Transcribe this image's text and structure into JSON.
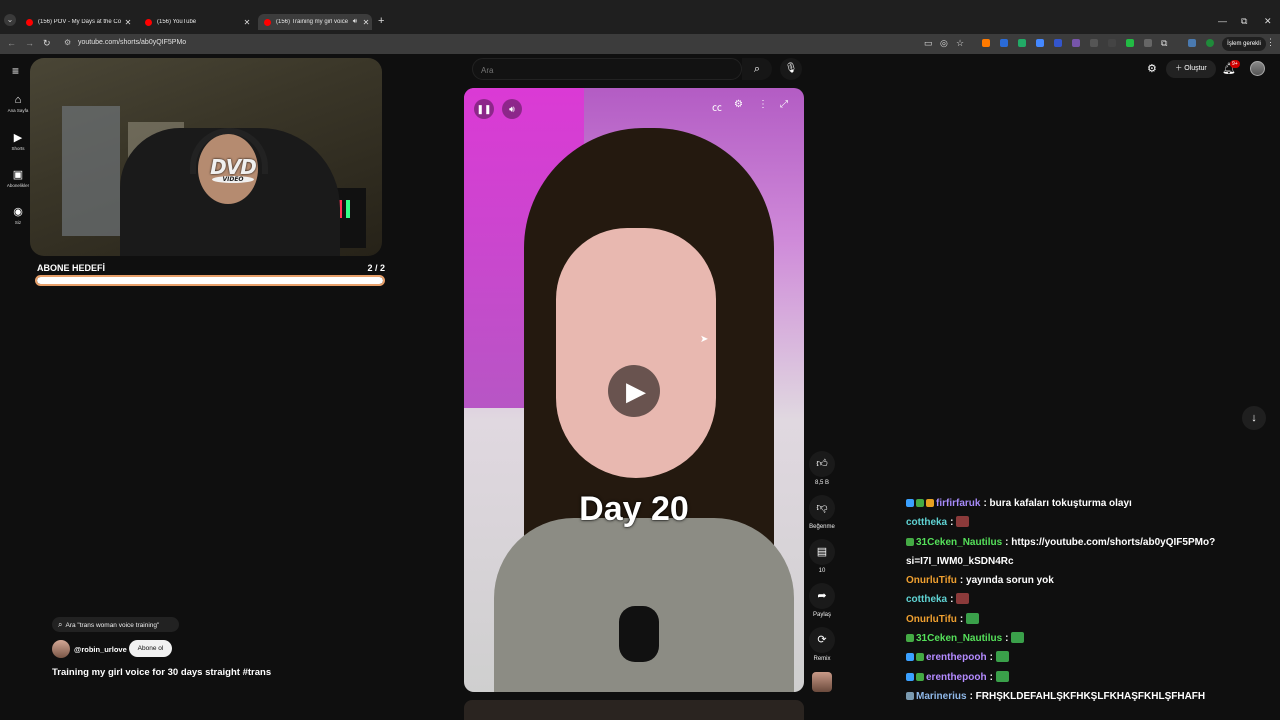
{
  "browser": {
    "tabs": [
      {
        "title": "(156) POV - My Days at the Co",
        "active": false
      },
      {
        "title": "(156) YouTube",
        "active": false
      },
      {
        "title": "(156) Training my girl voice",
        "active": true
      }
    ],
    "url": "youtube.com/shorts/ab0yQIF5PMo",
    "profile_label": "İşlem gerekli"
  },
  "youtube": {
    "sidebar": [
      {
        "label": "Ana Sayfa",
        "icon": "home-icon"
      },
      {
        "label": "Shorts",
        "icon": "shorts-icon"
      },
      {
        "label": "Abonelikler",
        "icon": "subscriptions-icon"
      },
      {
        "label": "Siz",
        "icon": "you-icon"
      }
    ],
    "search": {
      "placeholder": "Ara"
    },
    "create_label": "Oluştur",
    "notification_badge": "9+"
  },
  "overlay": {
    "goal_label": "ABONE HEDEFİ",
    "goal_count": "2  / 2",
    "goal_progress": 1.0,
    "dvd_logo": "DVD",
    "dvd_sub": "VIDEO"
  },
  "short": {
    "caption": "Day 20",
    "likes": "8,5 B",
    "dislike_label": "Beğenme",
    "comments": "10",
    "share_label": "Paylaş",
    "remix_label": "Remix",
    "search_suggestion": "Ara \"trans woman voice training\"",
    "channel": "@robin_urlove",
    "subscribe_label": "Abone ol",
    "title": "Training my girl voice for 30 days straight #trans"
  },
  "chat": [
    {
      "badges": [
        "#3aa0ff",
        "#44aa44",
        "#e8a020"
      ],
      "name": "firfirfaruk",
      "color": "#a78bfa",
      "text": ": bura kafaları tokuşturma olayı",
      "emote": null
    },
    {
      "badges": [],
      "name": "cottheka",
      "color": "#5fd3d3",
      "text": ": ",
      "emote": "#8b3a3a"
    },
    {
      "badges": [
        "#44aa44"
      ],
      "name": "31Ceken_Nautilus",
      "color": "#55e05a",
      "text": ": https://youtube.com/shorts/ab0yQIF5PMo?si=I7I_IWM0_kSDN4Rc",
      "emote": null
    },
    {
      "badges": [],
      "name": "OnurluTifu",
      "color": "#f0a030",
      "text": ": yayında sorun yok",
      "emote": null
    },
    {
      "badges": [],
      "name": "cottheka",
      "color": "#5fd3d3",
      "text": ": ",
      "emote": "#8b3a3a"
    },
    {
      "badges": [],
      "name": "OnurluTifu",
      "color": "#f0a030",
      "text": ": ",
      "emote": "#3aa04a"
    },
    {
      "badges": [
        "#44aa44"
      ],
      "name": "31Ceken_Nautilus",
      "color": "#55e05a",
      "text": ": ",
      "emote": "#3aa04a"
    },
    {
      "badges": [
        "#3aa0ff",
        "#44aa44"
      ],
      "name": "erenthepooh",
      "color": "#b48bff",
      "text": ": ",
      "emote": "#3aa04a"
    },
    {
      "badges": [
        "#3aa0ff",
        "#44aa44"
      ],
      "name": "erenthepooh",
      "color": "#b48bff",
      "text": ": ",
      "emote": "#3aa04a"
    },
    {
      "badges": [
        "#7a9ab0"
      ],
      "name": "Marinerius",
      "color": "#8fb8e8",
      "text": ": FRHŞKLDEFAHLŞKFHKŞLFKHAŞFKHLŞFHAFH",
      "emote": null
    }
  ]
}
